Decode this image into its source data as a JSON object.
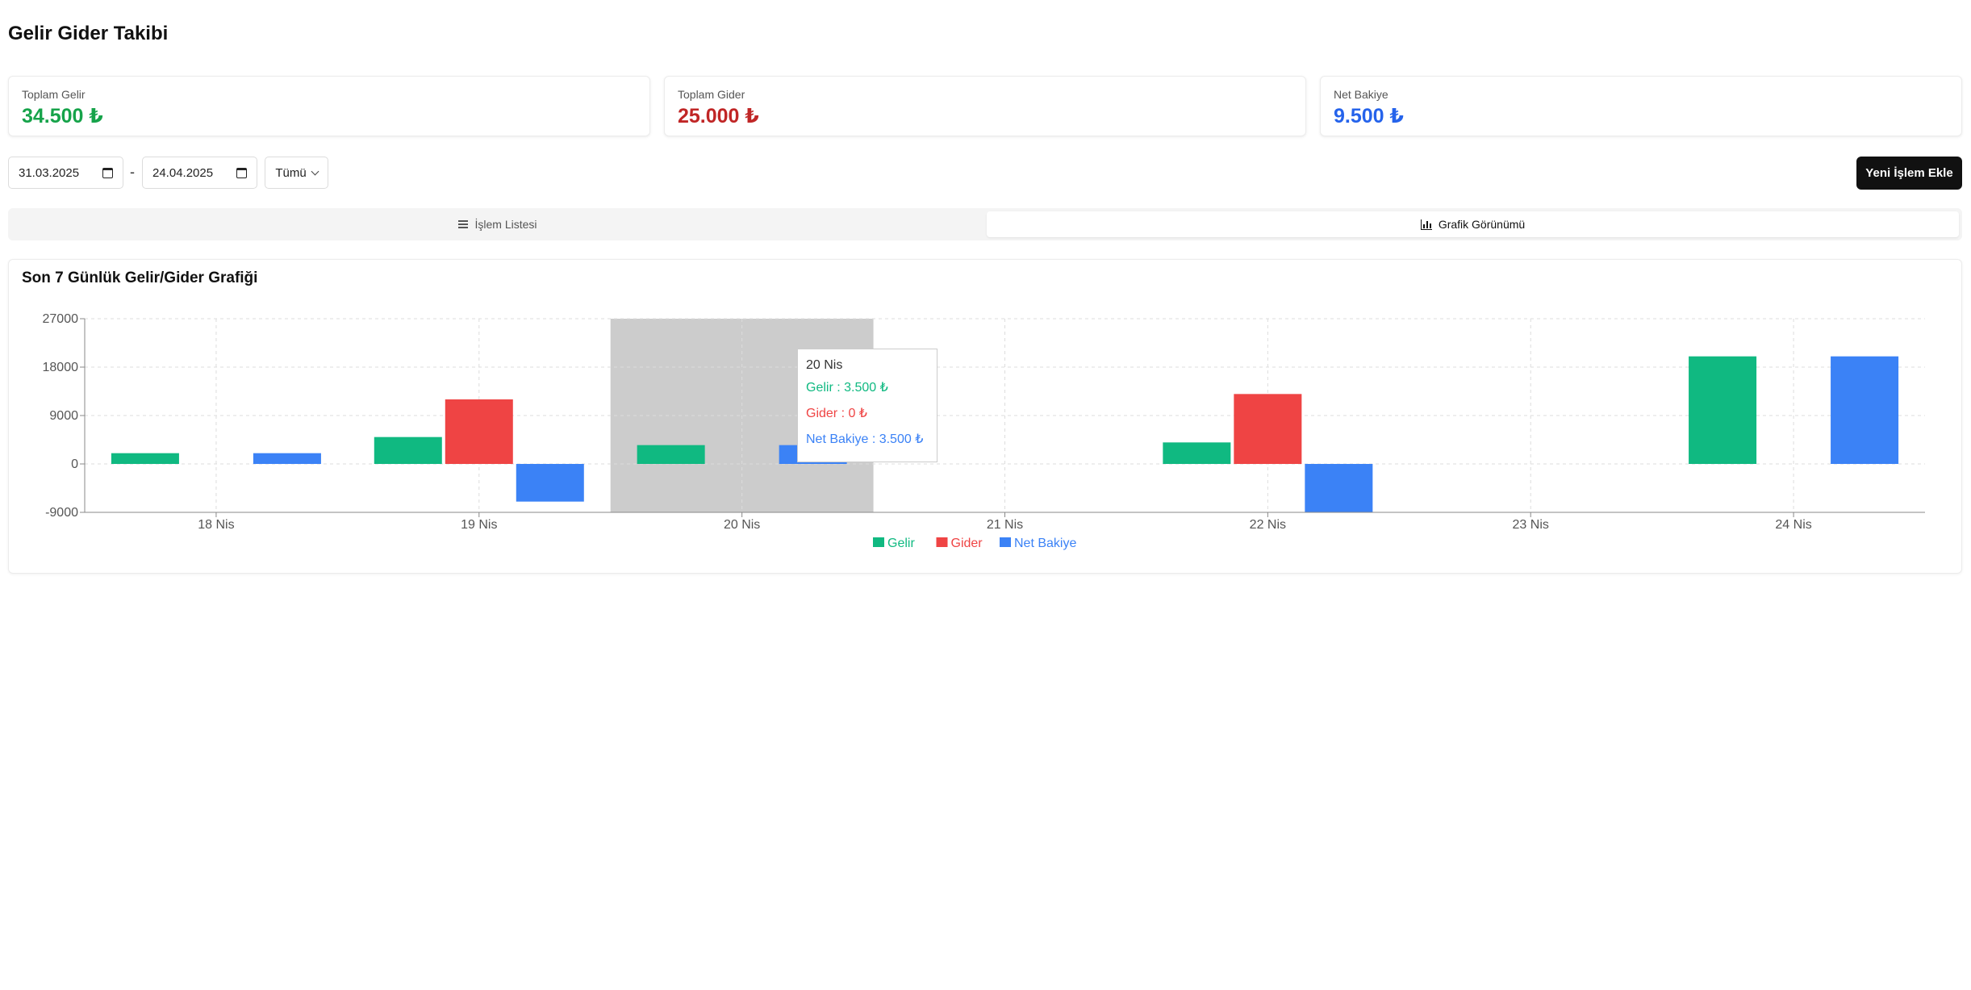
{
  "page": {
    "title": "Gelir Gider Takibi"
  },
  "summary": [
    {
      "label": "Toplam Gelir",
      "value": "34.500 ₺",
      "color": "#16a34a"
    },
    {
      "label": "Toplam Gider",
      "value": "25.000 ₺",
      "color": "#c02626"
    },
    {
      "label": "Net Bakiye",
      "value": "9.500 ₺",
      "color": "#2563eb"
    }
  ],
  "filters": {
    "start_date": "31.03.2025",
    "separator": "-",
    "end_date": "24.04.2025",
    "type_select": "Tümü"
  },
  "actions": {
    "add_label": "Yeni İşlem Ekle"
  },
  "tabs": [
    {
      "label": "İşlem Listesi",
      "icon": "list-icon",
      "active": false
    },
    {
      "label": "Grafik Görünümü",
      "icon": "bar-chart-icon",
      "active": true
    }
  ],
  "chart_data": {
    "type": "bar",
    "title": "Son 7 Günlük Gelir/Gider Grafiği",
    "categories": [
      "18 Nis",
      "19 Nis",
      "20 Nis",
      "21 Nis",
      "22 Nis",
      "23 Nis",
      "24 Nis"
    ],
    "series": [
      {
        "name": "Gelir",
        "color": "#10b981",
        "values": [
          2000,
          5000,
          3500,
          0,
          4000,
          0,
          20000
        ]
      },
      {
        "name": "Gider",
        "color": "#ef4444",
        "values": [
          0,
          12000,
          0,
          0,
          13000,
          0,
          0
        ]
      },
      {
        "name": "Net Bakiye",
        "color": "#3b82f6",
        "values": [
          2000,
          -7000,
          3500,
          0,
          -9000,
          0,
          20000
        ]
      }
    ],
    "ylim": [
      -9000,
      27000
    ],
    "yticks": [
      "27000",
      "18000",
      "9000",
      "0",
      "-9000"
    ],
    "grid": true,
    "legend": "bottom-center",
    "highlighted_category": "20 Nis",
    "tooltip": {
      "title": "20 Nis",
      "rows": [
        {
          "text": "Gelir : 3.500 ₺",
          "color": "#10b981"
        },
        {
          "text": "Gider : 0 ₺",
          "color": "#ef4444"
        },
        {
          "text": "Net Bakiye : 3.500 ₺",
          "color": "#3b82f6"
        }
      ]
    }
  }
}
